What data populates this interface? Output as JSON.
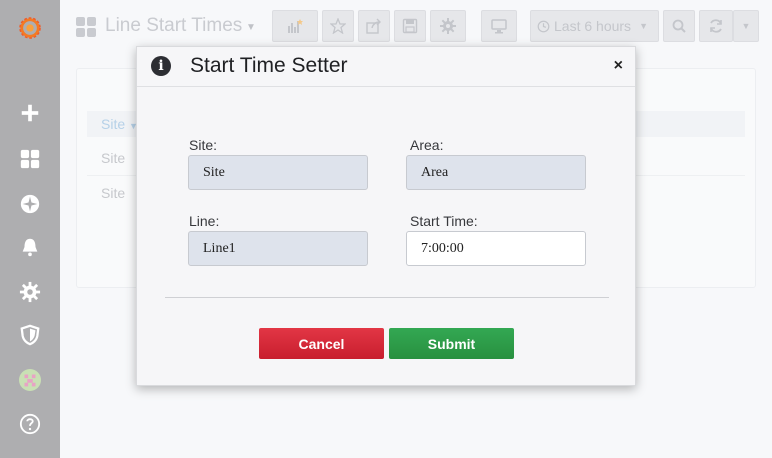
{
  "topbar": {
    "dashboard_title": "Line Start Times",
    "time_range": "Last 6 hours"
  },
  "panel": {
    "header": "Site",
    "rows": [
      "Site",
      "Site"
    ]
  },
  "modal": {
    "title": "Start Time Setter",
    "close": "×",
    "fields": {
      "site": {
        "label": "Site:",
        "value": "Site"
      },
      "area": {
        "label": "Area:",
        "value": "Area"
      },
      "line": {
        "label": "Line:",
        "value": "Line1"
      },
      "start_time": {
        "label": "Start Time:",
        "value": "7:00:00"
      }
    },
    "cancel_label": "Cancel",
    "submit_label": "Submit"
  },
  "colors": {
    "sidebar": "#aeaeb0",
    "cancel": "#d42a38",
    "submit": "#2f9e4a",
    "accent": "#f47a23"
  }
}
